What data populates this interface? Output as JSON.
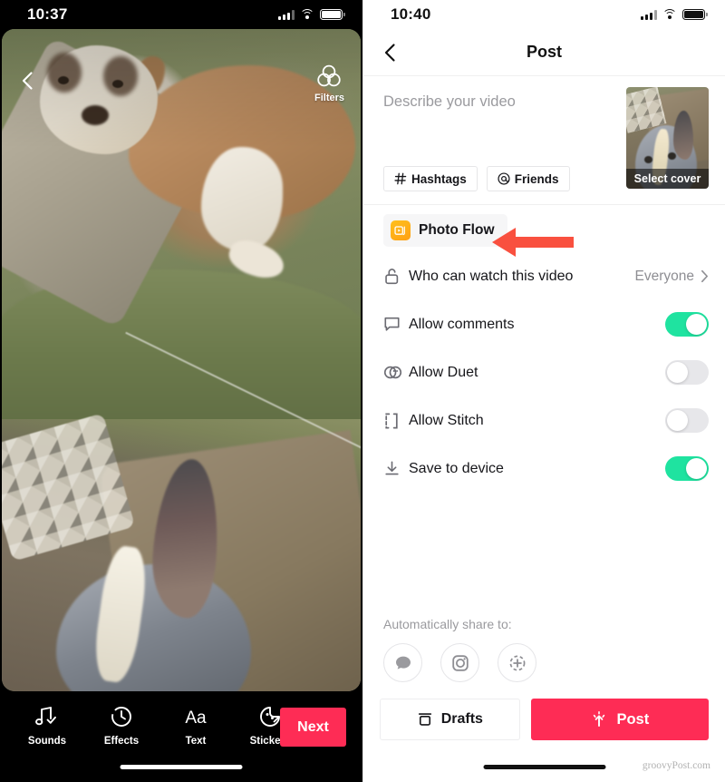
{
  "left_phone": {
    "status_bar": {
      "time": "10:37",
      "signal_icon": "cellular-bars-icon",
      "wifi_icon": "wifi-icon",
      "battery_icon": "battery-icon"
    },
    "back_icon": "back-chevron-icon",
    "filters": {
      "label": "Filters",
      "icon": "filters-circles-icon"
    },
    "toolbar": [
      {
        "label": "Sounds",
        "icon": "music-note-check-icon"
      },
      {
        "label": "Effects",
        "icon": "effects-clock-icon"
      },
      {
        "label": "Text",
        "icon": "text-aa-icon"
      },
      {
        "label": "Stickers",
        "icon": "sticker-face-icon"
      }
    ],
    "next_button": {
      "label": "Next",
      "color": "#FE2C55"
    }
  },
  "right_phone": {
    "status_bar": {
      "time": "10:40",
      "signal_icon": "cellular-bars-icon",
      "wifi_icon": "wifi-icon",
      "battery_icon": "battery-icon"
    },
    "nav": {
      "title": "Post",
      "back_icon": "back-chevron-icon"
    },
    "compose": {
      "placeholder": "Describe your video",
      "value": "",
      "chips": [
        {
          "label": "Hashtags",
          "icon": "hashtag-icon"
        },
        {
          "label": "Friends",
          "icon": "at-mention-icon"
        }
      ],
      "cover": {
        "label": "Select cover",
        "icon": "cover-thumbnail"
      }
    },
    "photo_flow": {
      "label": "Photo Flow",
      "icon": "photo-flow-icon",
      "icon_color": "#FFB31A"
    },
    "settings_rows": [
      {
        "label": "Who can watch this video",
        "icon": "unlocked-padlock-icon",
        "value": "Everyone",
        "chevron": "chevron-right-icon",
        "type": "link"
      },
      {
        "label": "Allow comments",
        "icon": "comment-bubble-icon",
        "toggle": "on",
        "type": "toggle"
      },
      {
        "label": "Allow Duet",
        "icon": "duet-icon",
        "toggle": "off",
        "type": "toggle"
      },
      {
        "label": "Allow Stitch",
        "icon": "stitch-brackets-icon",
        "toggle": "off",
        "type": "toggle"
      },
      {
        "label": "Save to device",
        "icon": "download-icon",
        "toggle": "on",
        "type": "toggle"
      }
    ],
    "share": {
      "title": "Automatically share to:",
      "targets": [
        {
          "icon": "message-bubble-icon",
          "name": "message"
        },
        {
          "icon": "instagram-icon",
          "name": "instagram"
        },
        {
          "icon": "more-plus-icon",
          "name": "more"
        }
      ]
    },
    "actions": {
      "drafts": {
        "label": "Drafts",
        "icon": "drafts-archive-icon"
      },
      "post": {
        "label": "Post",
        "icon": "post-sparkle-arrow-icon",
        "color": "#FE2C55"
      }
    },
    "watermark": "groovyPost.com"
  },
  "annotation": {
    "arrow_icon": "red-arrow-left-icon",
    "color": "#F9503F"
  },
  "colors": {
    "accent_red": "#FE2C55",
    "toggle_on_green": "#1FE3A0",
    "photo_flow_orange": "#FFB31A",
    "arrow_red": "#F9503F"
  }
}
